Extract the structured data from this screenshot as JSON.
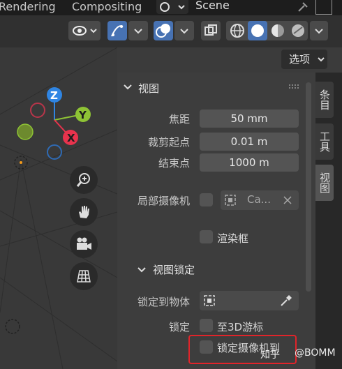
{
  "topbar": {
    "tab_rendering": "Rendering",
    "tab_compositing": "Compositing",
    "scene_name": "Scene"
  },
  "header": {
    "options_label": "选项"
  },
  "panel": {
    "view_header": "视图",
    "focal_label": "焦距",
    "focal_value": "50 mm",
    "clip_start_label": "裁剪起点",
    "clip_start_value": "0.01 m",
    "clip_end_label": "结束点",
    "clip_end_value": "1000 m",
    "local_camera_label": "局部摄像机",
    "local_camera_value": "Ca...",
    "render_border_label": "渲染框",
    "view_lock_header": "视图锁定",
    "lock_to_object_label": "锁定到物体",
    "lock_label": "锁定",
    "to_3d_cursor_label": "至3D游标",
    "lock_camera_label": "锁定摄像机到"
  },
  "sidetabs": {
    "item": "条目",
    "tool": "工具",
    "view": "视图"
  },
  "gizmo": {
    "z": "Z",
    "y": "Y",
    "x": "X"
  },
  "watermark": {
    "site": "知乎",
    "user": "@BOMM"
  },
  "colors": {
    "accent_blue": "#4772b3",
    "highlight_red": "#e0242a",
    "axis_x": "#e8334d",
    "axis_y": "#8ec335",
    "axis_z": "#2f85e3"
  }
}
